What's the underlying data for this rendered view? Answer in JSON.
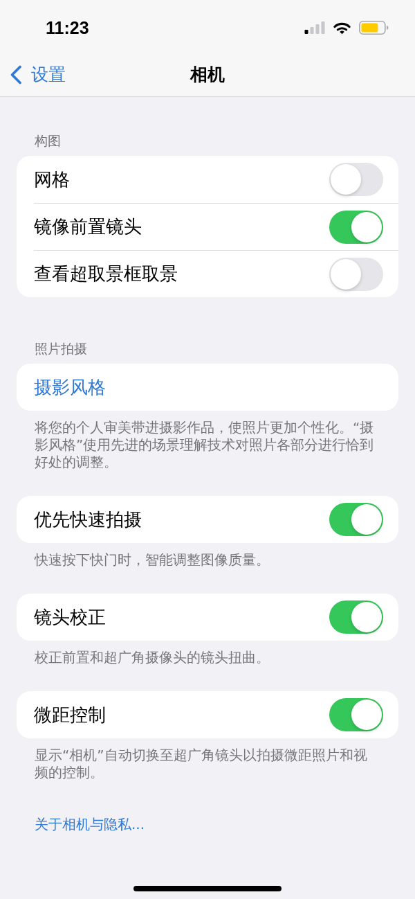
{
  "status_bar": {
    "time": "11:23"
  },
  "nav": {
    "back": "设置",
    "title": "相机"
  },
  "sections": [
    {
      "header": "构图",
      "rows": [
        {
          "kind": "toggle",
          "label": "网格",
          "on": false
        },
        {
          "kind": "toggle",
          "label": "镜像前置镜头",
          "on": true
        },
        {
          "kind": "toggle",
          "label": "查看超取景框取景",
          "on": false
        }
      ]
    },
    {
      "header": "照片拍摄",
      "rows": [
        {
          "kind": "link",
          "label": "摄影风格"
        }
      ],
      "footer": "将您的个人审美带进摄影作品，使照片更加个性化。“摄影风格”使用先进的场景理解技术对照片各部分进行恰到好处的调整。"
    },
    {
      "rows": [
        {
          "kind": "toggle",
          "label": "优先快速拍摄",
          "on": true
        }
      ],
      "footer": "快速按下快门时，智能调整图像质量。"
    },
    {
      "rows": [
        {
          "kind": "toggle",
          "label": "镜头校正",
          "on": true
        }
      ],
      "footer": "校正前置和超广角摄像头的镜头扭曲。"
    },
    {
      "rows": [
        {
          "kind": "toggle",
          "label": "微距控制",
          "on": true
        }
      ],
      "footer": "显示“相机”自动切换至超广角镜头以拍摄微距照片和视频的控制。"
    }
  ],
  "privacy_link": "关于相机与隐私..."
}
